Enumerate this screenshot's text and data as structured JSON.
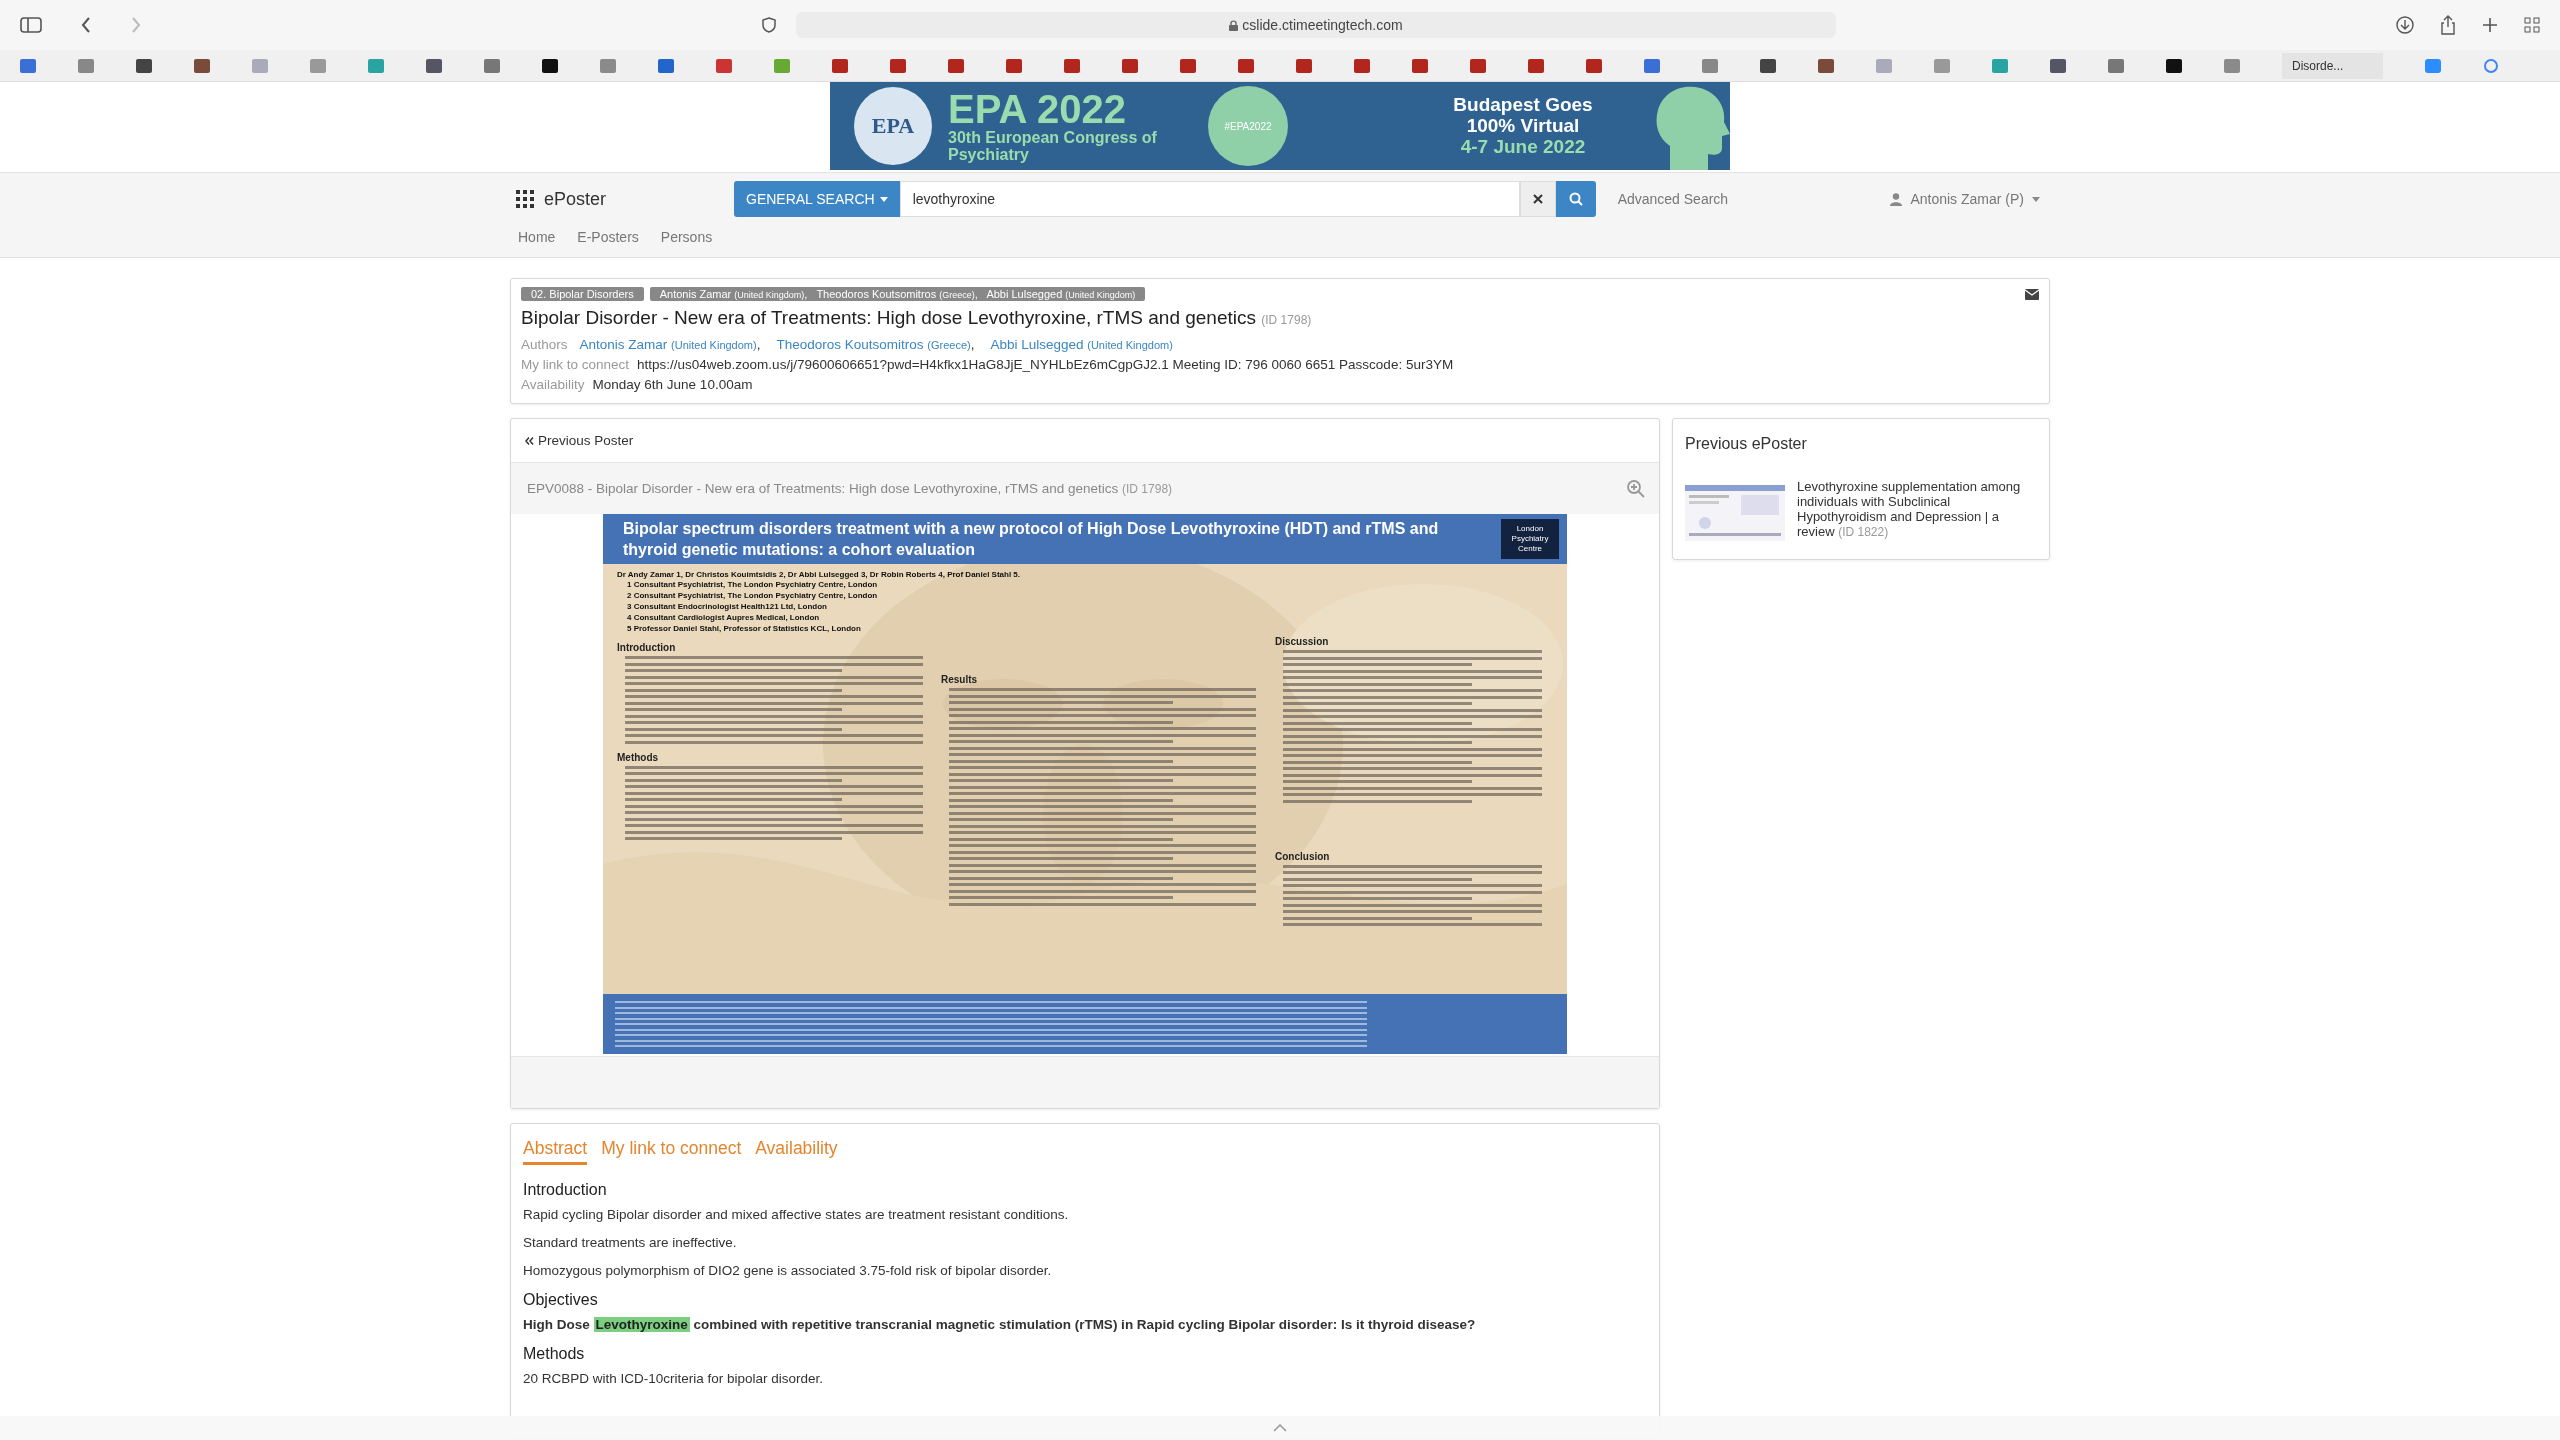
{
  "browser": {
    "url": "cslide.ctimeetingtech.com",
    "bookmark_tab": "Disorde..."
  },
  "banner": {
    "logo": "EPA",
    "title": "EPA 2022",
    "subtitle": "30th European Congress of Psychiatry",
    "hashtag": "#EPA2022",
    "tagline": "Budapest Goes 100% Virtual",
    "dates": "4-7 June 2022"
  },
  "navbar": {
    "brand": "ePoster",
    "search_mode": "GENERAL SEARCH",
    "search_value": "levothyroxine",
    "advanced": "Advanced Search",
    "user": "Antonis Zamar (P)",
    "links": [
      "Home",
      "E-Posters",
      "Persons"
    ]
  },
  "poster_info": {
    "category": "02. Bipolar Disorders",
    "tag_authors": [
      {
        "name": "Antonis Zamar",
        "country": "(United Kingdom)",
        "separator": ","
      },
      {
        "name": "Theodoros Koutsomitros",
        "country": "(Greece)",
        "separator": ","
      },
      {
        "name": "Abbi Lulsegged",
        "country": "(United Kingdom)"
      }
    ],
    "title": "Bipolar Disorder - New era of Treatments: High dose Levothyroxine, rTMS and genetics",
    "id": "(ID 1798)",
    "authors_label": "Authors",
    "authors": [
      {
        "name": "Antonis Zamar",
        "country": "(United Kingdom)",
        "separator": ","
      },
      {
        "name": "Theodoros Koutsomitros",
        "country": "(Greece)",
        "separator": ","
      },
      {
        "name": "Abbi Lulsegged",
        "country": "(United Kingdom)"
      }
    ],
    "link_label": "My link to connect",
    "link_value": "https://us04web.zoom.us/j/79600606651?pwd=H4kfkx1HaG8JjE_NYHLbEz6mCgpGJ2.1 Meeting ID: 796 0060 6651 Passcode: 5ur3YM",
    "availability_label": "Availability",
    "availability_value": "Monday 6th June 10.00am"
  },
  "viewer": {
    "previous": "Previous Poster",
    "caption": "EPV0088 - Bipolar Disorder - New era of Treatments: High dose Levothyroxine, rTMS and genetics",
    "caption_id": "(ID 1798)",
    "poster": {
      "title": "Bipolar spectrum disorders treatment with a new protocol of High Dose Levothyroxine (HDT) and rTMS and thyroid genetic mutations: a cohort evaluation",
      "logo": "London Psychiatry Centre",
      "authors": "Dr Andy Zamar 1, Dr Christos Kouimtsidis 2, Dr Abbi Lulsegged 3, Dr Robin Roberts 4, Prof Daniel Stahl 5.",
      "affiliations": [
        "1  Consultant Psychiatrist, The London Psychiatry Centre, London",
        "2  Consultant Psychiatrist, The London Psychiatry Centre, London",
        "3  Consultant Endocrinologist Health121 Ltd, London",
        "4  Consultant Cardiologist Aupres Medical, London",
        "5  Professor Daniel Stahl, Professor of Statistics KCL, London"
      ],
      "columns": [
        {
          "sections": [
            {
              "heading": "Introduction"
            },
            {
              "heading": "Methods"
            }
          ]
        },
        {
          "sections": [
            {
              "heading": "Results"
            }
          ]
        },
        {
          "sections": [
            {
              "heading": "Discussion"
            },
            {
              "heading": "Conclusion"
            }
          ]
        }
      ]
    }
  },
  "previous_eposter": {
    "heading": "Previous ePoster",
    "title": "Levothyroxine supplementation among individuals with Subclinical Hypothyroidism and Depression | a review",
    "id": "(ID 1822)"
  },
  "abstract": {
    "tabs": [
      {
        "label": "Abstract",
        "selected": true
      },
      {
        "label": "My link to connect",
        "selected": false
      },
      {
        "label": "Availability",
        "selected": false
      }
    ],
    "sections": [
      {
        "heading": "Introduction",
        "paragraphs": [
          {
            "text": "Rapid cycling Bipolar disorder and mixed affective states are treatment resistant conditions."
          },
          {
            "text": "Standard treatments are ineffective."
          },
          {
            "text": "Homozygous polymorphism of DIO2 gene is associated 3.75-fold risk of bipolar disorder."
          }
        ]
      },
      {
        "heading": "Objectives",
        "paragraphs": [
          {
            "text": "High Dose ",
            "highlight": "Levothyroxine",
            "after": " combined with repetitive transcranial magnetic stimulation (rTMS) in Rapid cycling Bipolar disorder: Is it thyroid disease?",
            "bold": true
          }
        ]
      },
      {
        "heading": "Methods",
        "paragraphs": [
          {
            "text": "20 RCBPD with ICD-10criteria for bipolar disorder."
          }
        ]
      }
    ]
  }
}
